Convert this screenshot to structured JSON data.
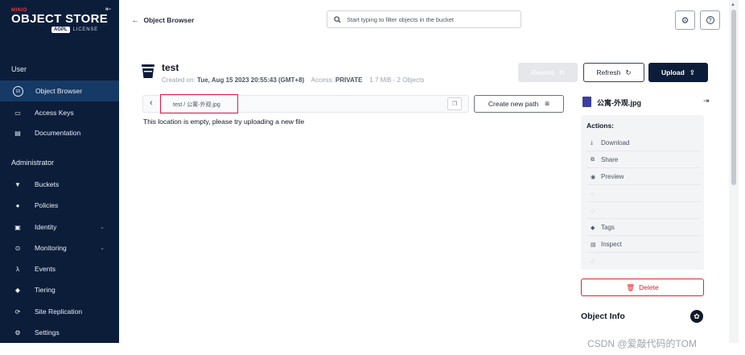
{
  "sidebar": {
    "logo": {
      "brand": "MINIO",
      "title": "OBJECT STORE",
      "badge": "AGPL",
      "license": "LICENSE"
    },
    "user_section": "User",
    "admin_section": "Administrator",
    "user_items": [
      {
        "label": "Object Browser",
        "icon": "object-browser-icon",
        "active": true
      },
      {
        "label": "Access Keys",
        "icon": "access-keys-icon"
      },
      {
        "label": "Documentation",
        "icon": "documentation-icon"
      }
    ],
    "admin_items": [
      {
        "label": "Buckets",
        "icon": "buckets-icon"
      },
      {
        "label": "Policies",
        "icon": "policies-icon"
      },
      {
        "label": "Identity",
        "icon": "identity-icon",
        "expandable": true
      },
      {
        "label": "Monitoring",
        "icon": "monitoring-icon",
        "expandable": true
      },
      {
        "label": "Events",
        "icon": "events-icon"
      },
      {
        "label": "Tiering",
        "icon": "tiering-icon"
      },
      {
        "label": "Site Replication",
        "icon": "site-replication-icon"
      },
      {
        "label": "Settings",
        "icon": "settings-icon"
      }
    ]
  },
  "header": {
    "back_label": "Object Browser",
    "search_placeholder": "Start typing to filter objects in the bucket"
  },
  "bucket": {
    "name": "test",
    "created_label": "Created on:",
    "created_value": "Tue, Aug 15 2023 20:55:43 (GMT+8)",
    "access_label": "Access:",
    "access_value": "PRIVATE",
    "usage": "1.7 MiB - 2 Objects"
  },
  "toolbar": {
    "rewind": "Rewind",
    "refresh": "Refresh",
    "upload": "Upload"
  },
  "path": {
    "value": "test / 公寓-外观.jpg",
    "create_new_path": "Create new path"
  },
  "empty_message": "This location is empty, please try uploading a new file",
  "object_panel": {
    "file_name": "公寓-外观.jpg",
    "actions_title": "Actions:",
    "actions": [
      {
        "label": "Download",
        "icon": "download-icon",
        "enabled": true
      },
      {
        "label": "Share",
        "icon": "share-icon",
        "enabled": true
      },
      {
        "label": "Preview",
        "icon": "preview-icon",
        "enabled": true
      },
      {
        "label": "",
        "icon": "legal-hold-icon",
        "enabled": false
      },
      {
        "label": "",
        "icon": "retention-icon",
        "enabled": false
      },
      {
        "label": "Tags",
        "icon": "tags-icon",
        "enabled": true
      },
      {
        "label": "Inspect",
        "icon": "inspect-icon",
        "enabled": true
      },
      {
        "label": "",
        "icon": "versions-icon",
        "enabled": false
      }
    ],
    "delete_label": "Delete",
    "object_info_title": "Object Info"
  },
  "watermark": "CSDN @爱敲代码的TOM",
  "colors": {
    "sidebar_bg": "#0c1d3a",
    "active_item": "#163a66",
    "delete": "#dc2626",
    "path_highlight": "#e11d48"
  }
}
